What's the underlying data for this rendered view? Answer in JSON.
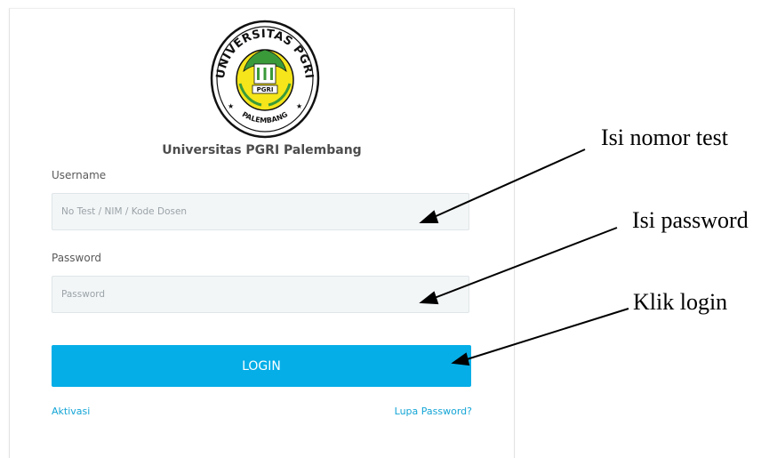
{
  "university": {
    "name": "Universitas PGRI Palembang",
    "logo_arc_text": "UNIVERSITAS PGRI",
    "logo_bottom_text": "PALEMBANG",
    "logo_center_text": "PGRI"
  },
  "form": {
    "username_label": "Username",
    "username_placeholder": "No Test / NIM / Kode Dosen",
    "username_value": "",
    "password_label": "Password",
    "password_placeholder": "Password",
    "password_value": "",
    "login_label": "LOGIN",
    "aktivasi_label": "Aktivasi",
    "lupa_password_label": "Lupa Password?"
  },
  "annotations": {
    "username_note": "Isi nomor test",
    "password_note": "Isi password",
    "login_note": "Klik login"
  },
  "colors": {
    "login_button": "#06aee7",
    "link": "#14a5d6",
    "input_bg": "#f3f6f7",
    "logo_yellow": "#f5e51a",
    "logo_green": "#3a9a3a"
  }
}
